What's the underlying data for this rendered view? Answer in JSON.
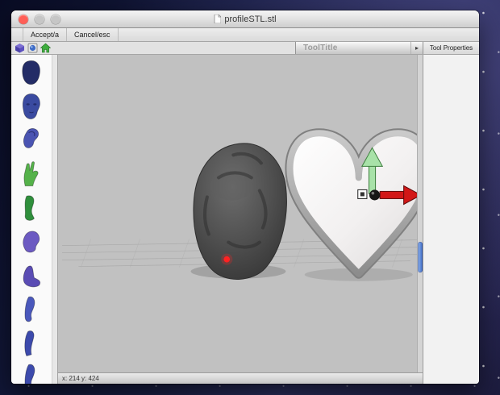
{
  "window": {
    "title": "profileSTL.stl"
  },
  "menubar": {
    "accept_label": "Accept/a",
    "cancel_label": "Cancel/esc"
  },
  "toolbar": {
    "tool_title": "ToolTitle",
    "disclosure_glyph": "▸",
    "tool_properties_label": "Tool Properties"
  },
  "sidebar": {
    "items": [
      {
        "name": "head-back",
        "color": "#232c66"
      },
      {
        "name": "face",
        "color": "#3a4aa0"
      },
      {
        "name": "ear",
        "color": "#4a54b2"
      },
      {
        "name": "hand",
        "color": "#55b24a"
      },
      {
        "name": "foot-green",
        "color": "#2f8f3c"
      },
      {
        "name": "torso",
        "color": "#6c5ac2"
      },
      {
        "name": "foot",
        "color": "#5a4cb4"
      },
      {
        "name": "leg",
        "color": "#4a58bc"
      },
      {
        "name": "arm",
        "color": "#3c4aac"
      },
      {
        "name": "limb",
        "color": "#3c4aac"
      }
    ]
  },
  "viewport": {
    "colors": {
      "background": "#c1c1c1",
      "mesh": "#4a4a4a",
      "heart_fill": "#f4f2f2",
      "heart_shell": "#9b9b9b",
      "arrow_up": "#a8e2a8",
      "arrow_right": "#d21717",
      "pivot": "#161616",
      "marker": "#ff2222",
      "scroll_thumb": "#4f7fd0"
    }
  },
  "statusbar": {
    "coordinates": "x: 214 y: 424"
  }
}
